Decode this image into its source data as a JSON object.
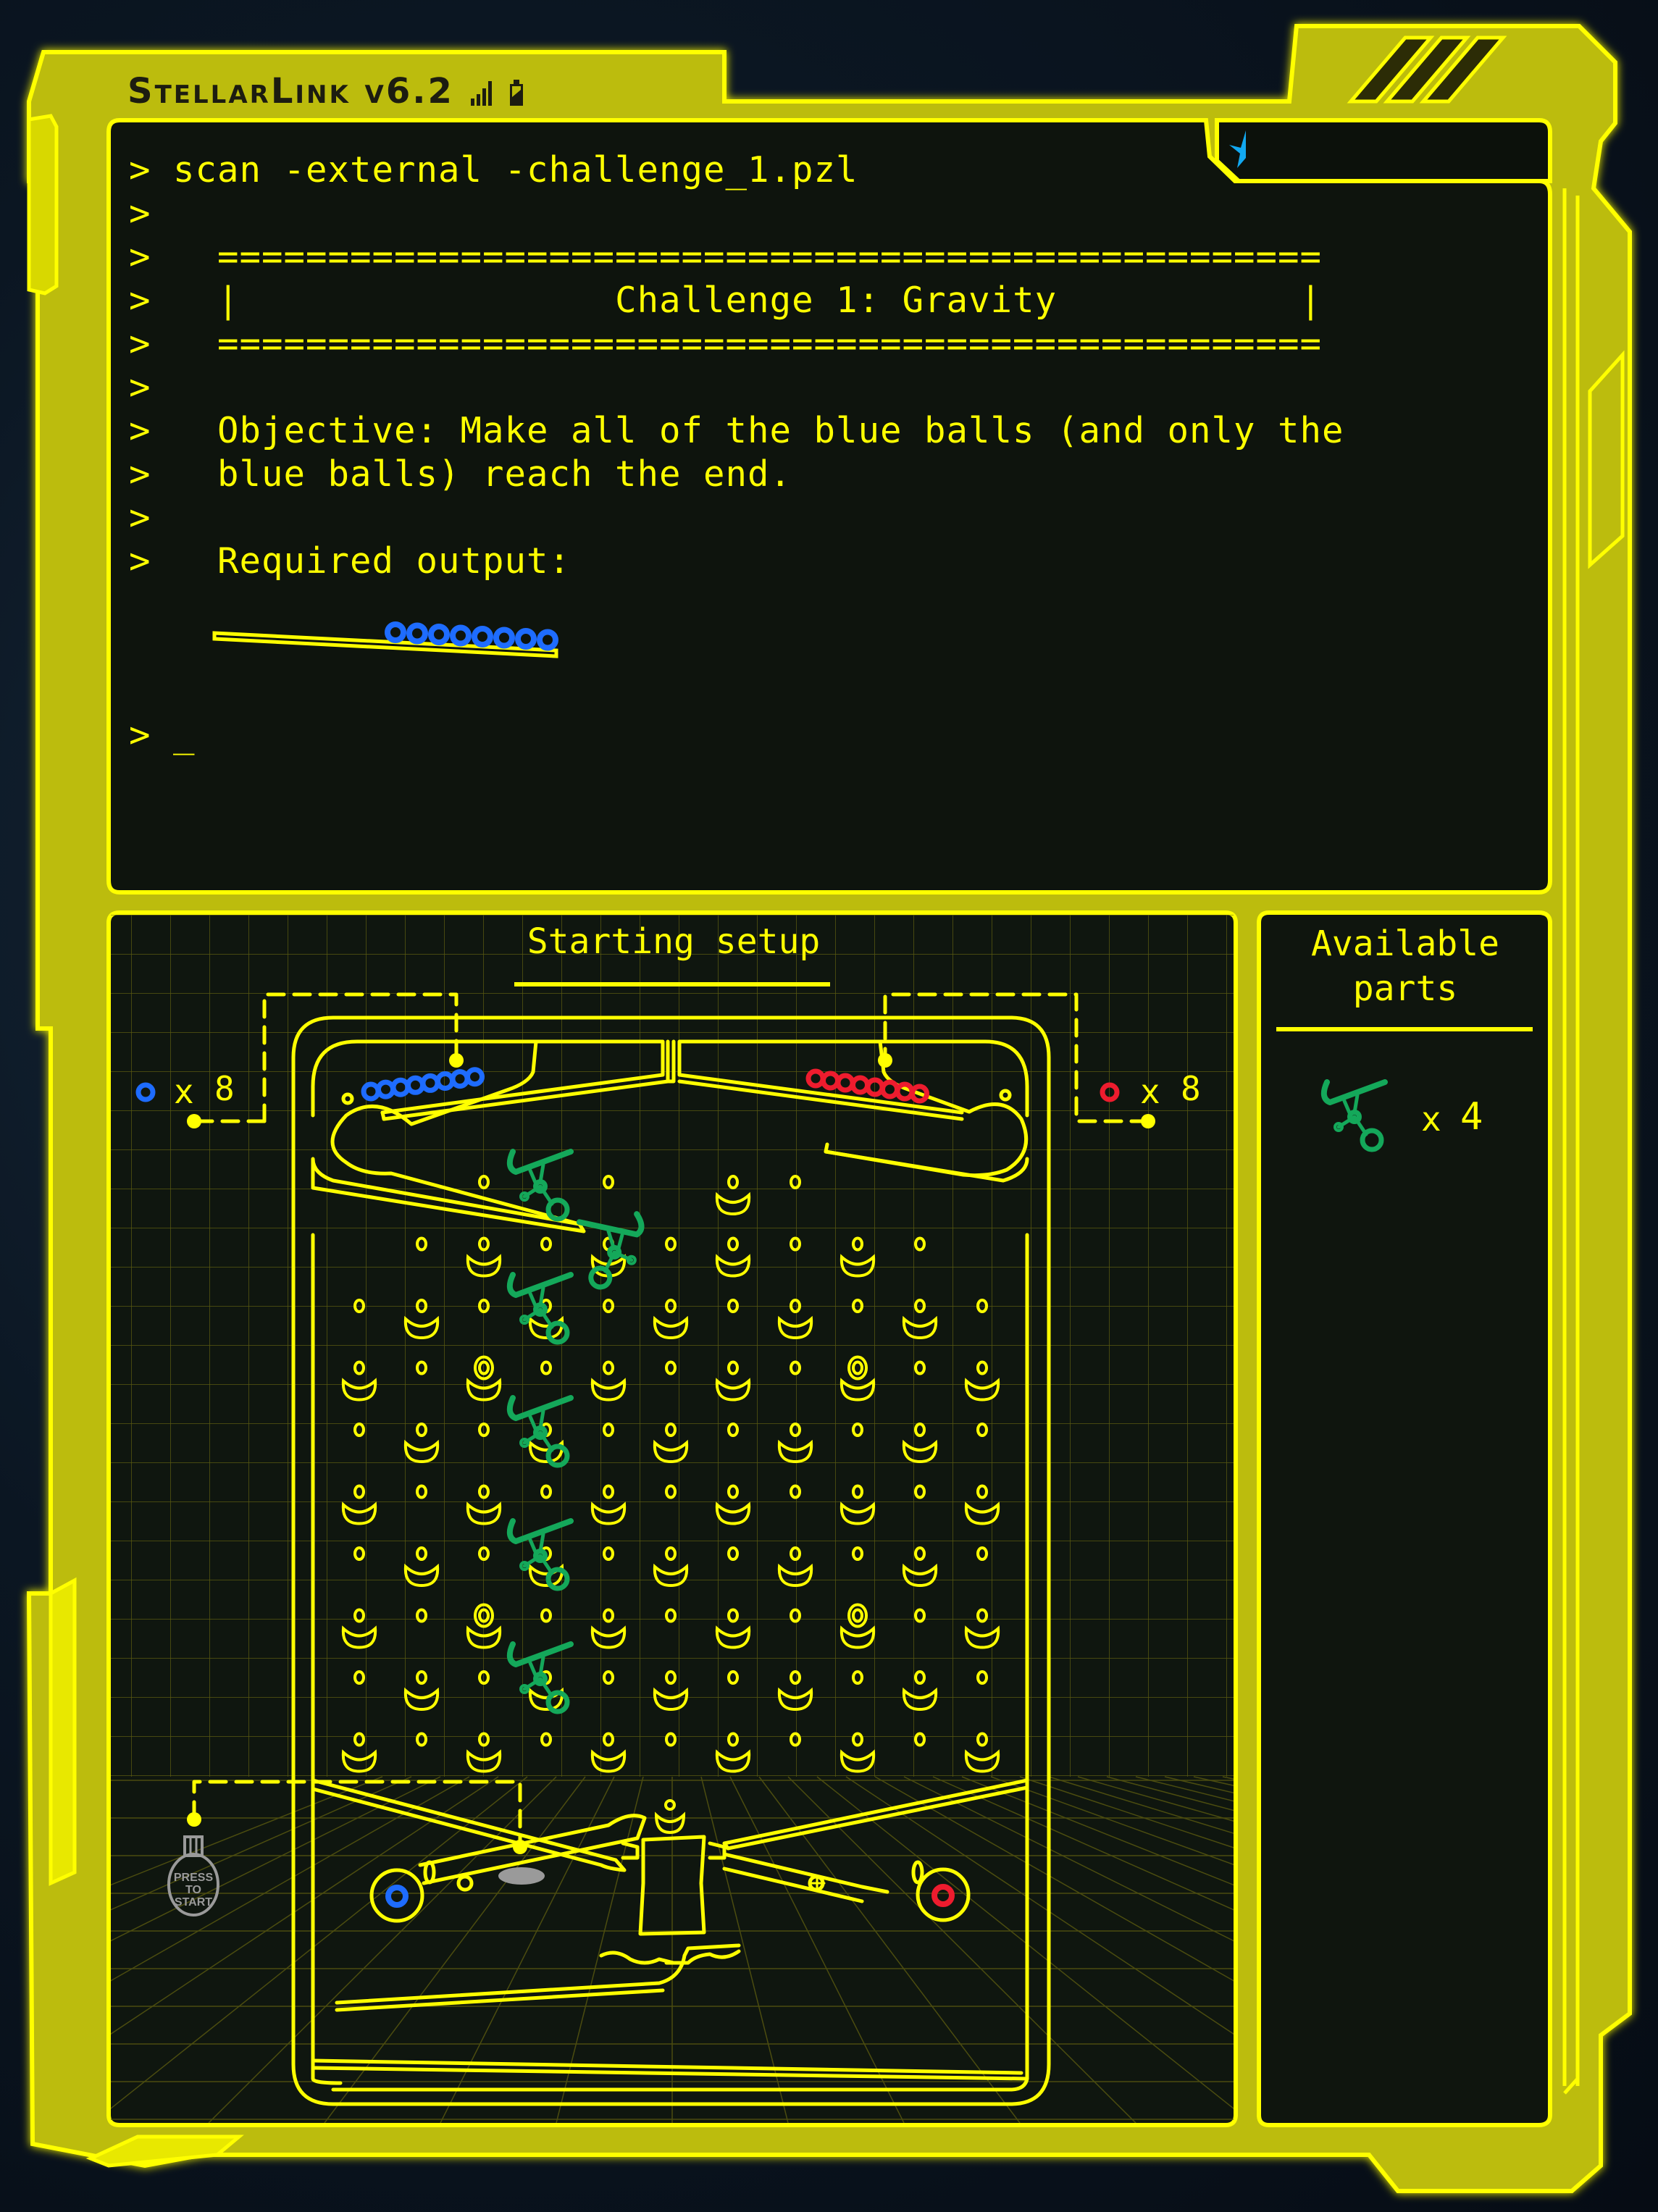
{
  "app": {
    "title": "StellarLink v6.2",
    "status_icons": [
      "signal-strength-icon",
      "battery-icon"
    ],
    "corner_icon": "blue-star-icon"
  },
  "colors": {
    "frame": "#c8c800",
    "accent": "#ffff00",
    "blue_ball": "#1e6cff",
    "red_ball": "#ee1c2e",
    "part_green": "#14a85a",
    "button_gray": "#9a9a9a",
    "star_blue": "#12a8f0"
  },
  "terminal": {
    "prompt": ">",
    "command": "scan -external -challenge_1.pzl",
    "rule_line": "==================================================",
    "box_left": "|",
    "box_right": "|",
    "challenge_title": "Challenge 1: Gravity",
    "objective_line1": "Objective: Make all of the blue balls (and only the",
    "objective_line2": "blue balls) reach the end.",
    "required_label": "Required output:",
    "cursor": "_",
    "required_output": {
      "ball_color": "blue",
      "ball_count": 8
    }
  },
  "setup_panel": {
    "heading": "Starting setup",
    "left_dispenser": {
      "ball_color": "blue",
      "multiplier": "x",
      "count": "8",
      "ball_count": 8
    },
    "right_dispenser": {
      "ball_color": "red",
      "multiplier": "x",
      "count": "8",
      "ball_count": 8
    },
    "start_button": {
      "line1": "PRESS",
      "line2": "TO",
      "line3": "START"
    },
    "placed_parts": {
      "type": "ramp",
      "count": 6
    },
    "bottom_left_marker": "blue",
    "bottom_right_marker": "red"
  },
  "parts_panel": {
    "heading_line1": "Available",
    "heading_line2": "parts",
    "items": [
      {
        "icon": "ramp-part-icon",
        "multiplier": "x",
        "count": "4"
      }
    ]
  }
}
